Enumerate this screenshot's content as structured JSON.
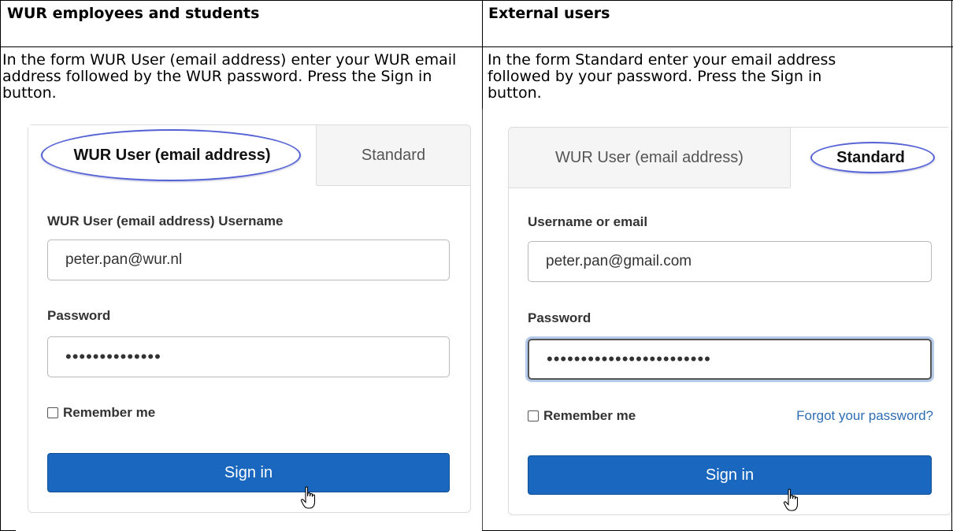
{
  "left": {
    "header": "WUR employees and students",
    "instructions": "In the  form WUR User (email address)  enter your WUR email address  followed by  the WUR password. Press the Sign in button.",
    "form": {
      "tabs": [
        "WUR User (email address)",
        "Standard"
      ],
      "active_tab": "WUR User (email address)",
      "username_label": "WUR User (email address) Username",
      "username_value": "peter.pan@wur.nl",
      "password_label": "Password",
      "password_value": "••••••••••••••",
      "remember_label": "Remember me",
      "signin_label": "Sign in"
    }
  },
  "right": {
    "header": "External users",
    "instructions": "In the form Standard enter your email address followed by your password. Press the Sign in button.",
    "form": {
      "tabs": [
        "WUR User (email address)",
        "Standard"
      ],
      "active_tab": "Standard",
      "username_label": "Username or email",
      "username_value": "peter.pan@gmail.com",
      "password_label": "Password",
      "password_value": "••••••••••••••••••••••••",
      "remember_label": "Remember me",
      "forgot_label": "Forgot your password?",
      "signin_label": "Sign in"
    }
  },
  "colors": {
    "accent": "#1a67bf",
    "link": "#2e6db3",
    "highlight": "#5562d6",
    "focus_ring": "#b6cbe9"
  },
  "icons": [
    "hand-pointer-cursor-icon",
    "checkbox-icon"
  ]
}
